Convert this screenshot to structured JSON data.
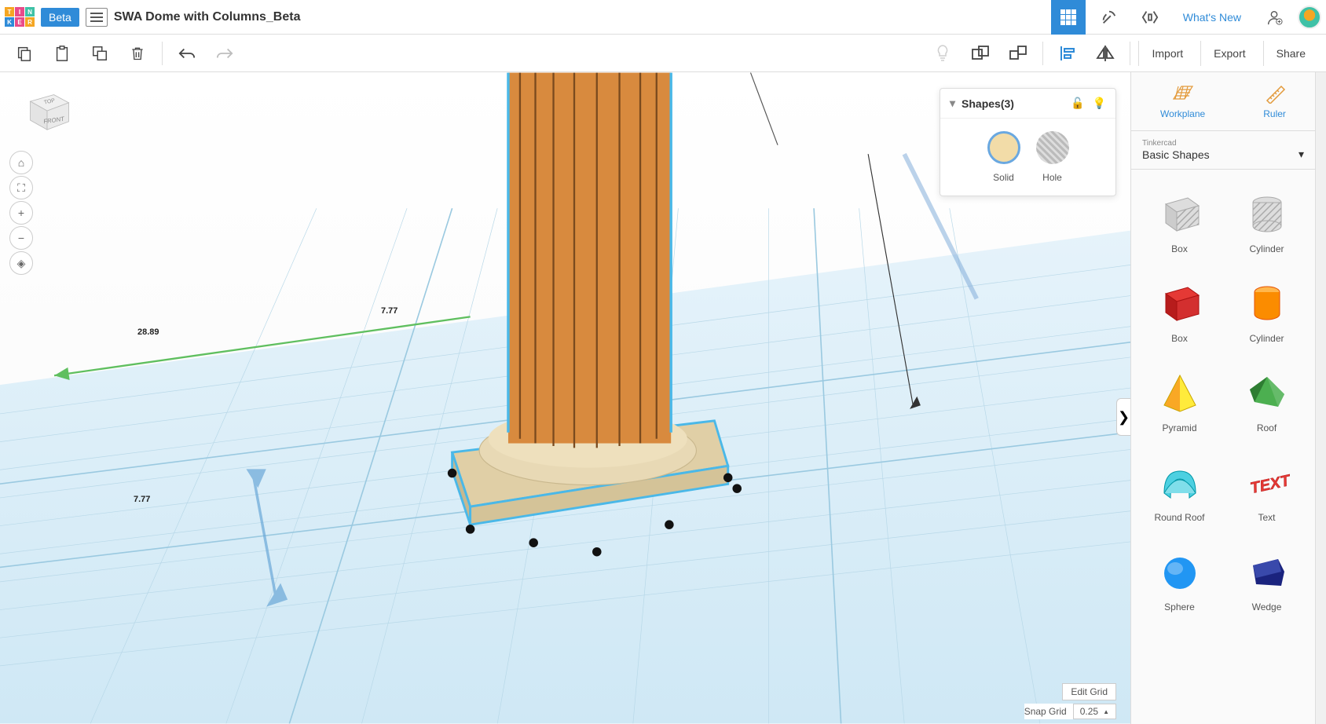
{
  "header": {
    "beta": "Beta",
    "title": "SWA Dome with Columns_Beta",
    "whats_new": "What's New"
  },
  "toolbar": {
    "import": "Import",
    "export": "Export",
    "share": "Share"
  },
  "inspector": {
    "title": "Shapes(3)",
    "solid": "Solid",
    "hole": "Hole"
  },
  "right_panel": {
    "workplane": "Workplane",
    "ruler": "Ruler",
    "dd_small": "Tinkercad",
    "dd_main": "Basic Shapes",
    "shapes": [
      {
        "name": "Box"
      },
      {
        "name": "Cylinder"
      },
      {
        "name": "Box"
      },
      {
        "name": "Cylinder"
      },
      {
        "name": "Pyramid"
      },
      {
        "name": "Roof"
      },
      {
        "name": "Round Roof"
      },
      {
        "name": "Text"
      },
      {
        "name": "Sphere"
      },
      {
        "name": "Wedge"
      }
    ]
  },
  "viewcube": {
    "top": "TOP",
    "front": "FRONT"
  },
  "dimensions": {
    "a": "28.89",
    "b": "7.77",
    "c": "7.77"
  },
  "footer": {
    "edit_grid": "Edit Grid",
    "snap_label": "Snap Grid",
    "snap_val": "0.25"
  }
}
